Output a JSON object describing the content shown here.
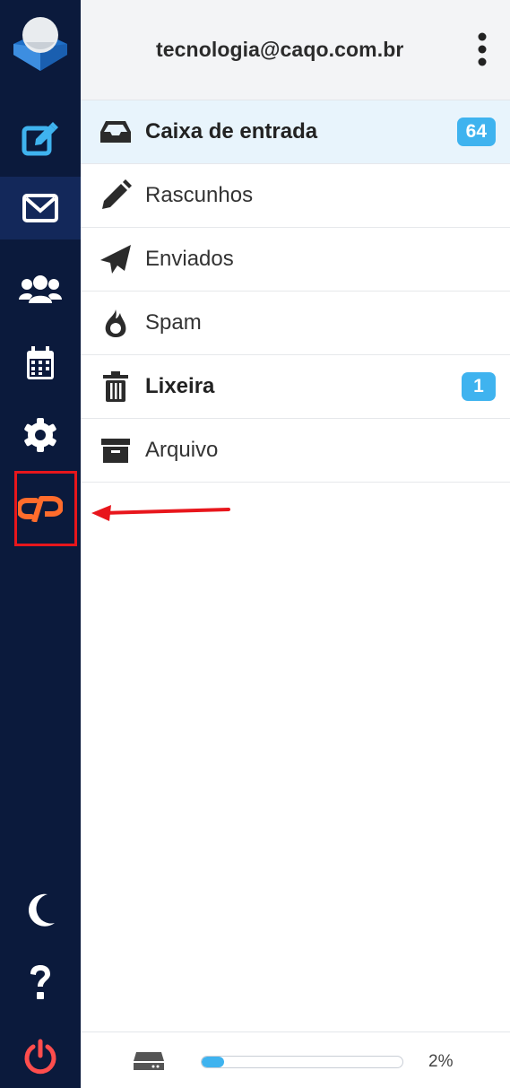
{
  "header": {
    "account": "tecnologia@caqo.com.br",
    "menu_icon": "kebab-icon"
  },
  "rail": {
    "items": [
      {
        "name": "logo",
        "icon": "app-logo"
      },
      {
        "name": "compose",
        "icon": "compose-icon"
      },
      {
        "name": "mail",
        "icon": "envelope-icon",
        "active": true
      },
      {
        "name": "contacts",
        "icon": "users-icon"
      },
      {
        "name": "calendar",
        "icon": "calendar-icon"
      },
      {
        "name": "settings",
        "icon": "gear-icon"
      },
      {
        "name": "cpanel",
        "icon": "cpanel-icon"
      },
      {
        "name": "theme",
        "icon": "moon-icon"
      },
      {
        "name": "help",
        "icon": "help-icon"
      },
      {
        "name": "logout",
        "icon": "power-icon"
      }
    ],
    "accent": "#0b1a3c",
    "cpanel_color": "#ff6c2c",
    "logout_color": "#ff4d4d"
  },
  "folders": [
    {
      "label": "Caixa de entrada",
      "icon": "inbox-icon",
      "badge": "64",
      "bold": true,
      "selected": true
    },
    {
      "label": "Rascunhos",
      "icon": "pencil-icon"
    },
    {
      "label": "Enviados",
      "icon": "paper-plane-icon"
    },
    {
      "label": "Spam",
      "icon": "fire-icon"
    },
    {
      "label": "Lixeira",
      "icon": "trash-icon",
      "badge": "1",
      "bold": true
    },
    {
      "label": "Arquivo",
      "icon": "archive-icon"
    }
  ],
  "quota": {
    "percent_text": "2%",
    "percent": 2,
    "icon": "storage-icon"
  },
  "annotation": {
    "highlight_color": "#e8161c"
  }
}
